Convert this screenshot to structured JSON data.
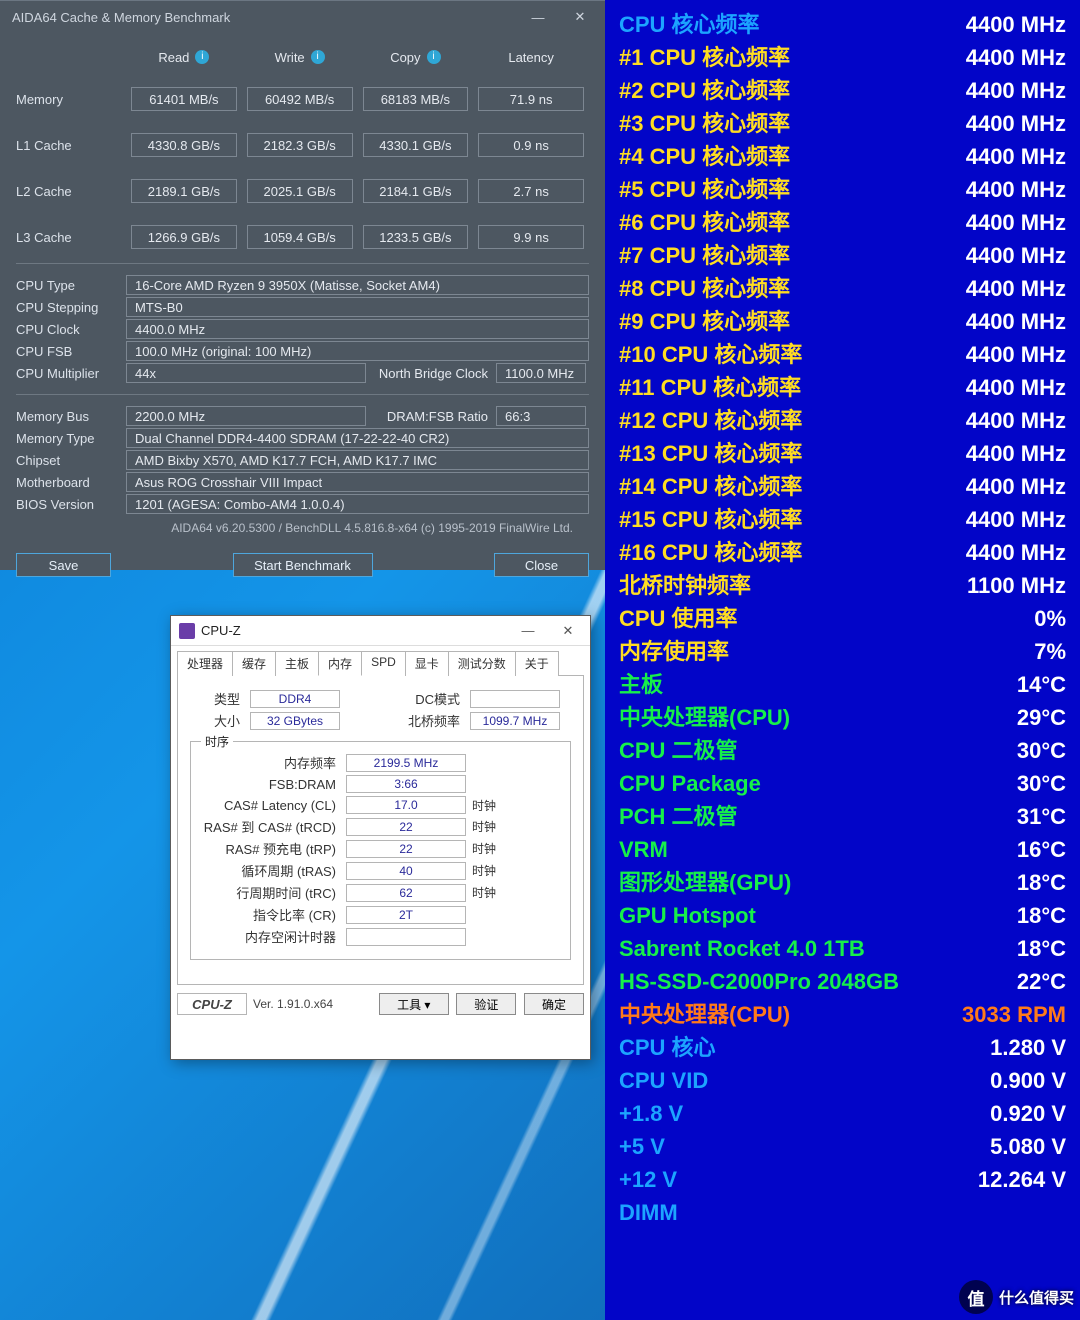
{
  "aida": {
    "title": "AIDA64 Cache & Memory Benchmark",
    "headers": {
      "read": "Read",
      "write": "Write",
      "copy": "Copy",
      "latency": "Latency"
    },
    "rows": [
      {
        "label": "Memory",
        "read": "61401 MB/s",
        "write": "60492 MB/s",
        "copy": "68183 MB/s",
        "latency": "71.9 ns"
      },
      {
        "label": "L1 Cache",
        "read": "4330.8 GB/s",
        "write": "2182.3 GB/s",
        "copy": "4330.1 GB/s",
        "latency": "0.9 ns"
      },
      {
        "label": "L2 Cache",
        "read": "2189.1 GB/s",
        "write": "2025.1 GB/s",
        "copy": "2184.1 GB/s",
        "latency": "2.7 ns"
      },
      {
        "label": "L3 Cache",
        "read": "1266.9 GB/s",
        "write": "1059.4 GB/s",
        "copy": "1233.5 GB/s",
        "latency": "9.9 ns"
      }
    ],
    "cpu": {
      "type_k": "CPU Type",
      "type_v": "16-Core AMD Ryzen 9 3950X  (Matisse, Socket AM4)",
      "step_k": "CPU Stepping",
      "step_v": "MTS-B0",
      "clock_k": "CPU Clock",
      "clock_v": "4400.0 MHz",
      "fsb_k": "CPU FSB",
      "fsb_v": "100.0 MHz   (original: 100 MHz)",
      "mult_k": "CPU Multiplier",
      "mult_v": "44x",
      "nb_k": "North Bridge Clock",
      "nb_v": "1100.0 MHz"
    },
    "mem": {
      "bus_k": "Memory Bus",
      "bus_v": "2200.0 MHz",
      "ratio_k": "DRAM:FSB Ratio",
      "ratio_v": "66:3",
      "type_k": "Memory Type",
      "type_v": "Dual Channel DDR4-4400 SDRAM   (17-22-22-40 CR2)",
      "chip_k": "Chipset",
      "chip_v": "AMD Bixby X570, AMD K17.7 FCH, AMD K17.7 IMC",
      "mb_k": "Motherboard",
      "mb_v": "Asus ROG Crosshair VIII Impact",
      "bios_k": "BIOS Version",
      "bios_v": "1201  (AGESA: Combo-AM4 1.0.0.4)"
    },
    "footer": "AIDA64 v6.20.5300 / BenchDLL 4.5.816.8-x64   (c) 1995-2019 FinalWire Ltd.",
    "buttons": {
      "save": "Save",
      "start": "Start Benchmark",
      "close": "Close"
    }
  },
  "cpuz": {
    "title": "CPU-Z",
    "tabs": [
      "处理器",
      "缓存",
      "主板",
      "内存",
      "SPD",
      "显卡",
      "测试分数",
      "关于"
    ],
    "active_tab": "内存",
    "type_k": "类型",
    "type_v": "DDR4",
    "size_k": "大小",
    "size_v": "32 GBytes",
    "dc_k": "DC模式",
    "nb_k": "北桥频率",
    "nb_v": "1099.7 MHz",
    "group": "时序",
    "timings": [
      {
        "k": "内存频率",
        "v": "2199.5 MHz",
        "u": ""
      },
      {
        "k": "FSB:DRAM",
        "v": "3:66",
        "u": ""
      },
      {
        "k": "CAS# Latency (CL)",
        "v": "17.0",
        "u": "时钟"
      },
      {
        "k": "RAS# 到 CAS# (tRCD)",
        "v": "22",
        "u": "时钟"
      },
      {
        "k": "RAS# 预充电 (tRP)",
        "v": "22",
        "u": "时钟"
      },
      {
        "k": "循环周期 (tRAS)",
        "v": "40",
        "u": "时钟"
      },
      {
        "k": "行周期时间 (tRC)",
        "v": "62",
        "u": "时钟"
      },
      {
        "k": "指令比率 (CR)",
        "v": "2T",
        "u": ""
      },
      {
        "k": "内存空闲计时器",
        "v": "",
        "u": "",
        "gray": true
      }
    ],
    "logo": "CPU-Z",
    "ver": "Ver. 1.91.0.x64",
    "btn_tool": "工具",
    "btn_verify": "验证",
    "btn_ok": "确定"
  },
  "mon": {
    "freq_rows": [
      {
        "cls": "blue",
        "k": "CPU 核心频率",
        "v": "4400 MHz"
      },
      {
        "cls": "yellow",
        "k": "#1 CPU 核心频率",
        "v": "4400 MHz"
      },
      {
        "cls": "yellow",
        "k": "#2 CPU 核心频率",
        "v": "4400 MHz"
      },
      {
        "cls": "yellow",
        "k": "#3 CPU 核心频率",
        "v": "4400 MHz"
      },
      {
        "cls": "yellow",
        "k": "#4 CPU 核心频率",
        "v": "4400 MHz"
      },
      {
        "cls": "yellow",
        "k": "#5 CPU 核心频率",
        "v": "4400 MHz"
      },
      {
        "cls": "yellow",
        "k": "#6 CPU 核心频率",
        "v": "4400 MHz"
      },
      {
        "cls": "yellow",
        "k": "#7 CPU 核心频率",
        "v": "4400 MHz"
      },
      {
        "cls": "yellow",
        "k": "#8 CPU 核心频率",
        "v": "4400 MHz"
      },
      {
        "cls": "yellow",
        "k": "#9 CPU 核心频率",
        "v": "4400 MHz"
      },
      {
        "cls": "yellow",
        "k": "#10 CPU 核心频率",
        "v": "4400 MHz"
      },
      {
        "cls": "yellow",
        "k": "#11 CPU 核心频率",
        "v": "4400 MHz"
      },
      {
        "cls": "yellow",
        "k": "#12 CPU 核心频率",
        "v": "4400 MHz"
      },
      {
        "cls": "yellow",
        "k": "#13 CPU 核心频率",
        "v": "4400 MHz"
      },
      {
        "cls": "yellow",
        "k": "#14 CPU 核心频率",
        "v": "4400 MHz"
      },
      {
        "cls": "yellow",
        "k": "#15 CPU 核心频率",
        "v": "4400 MHz"
      },
      {
        "cls": "yellow",
        "k": "#16 CPU 核心频率",
        "v": "4400 MHz"
      },
      {
        "cls": "yellow",
        "k": "北桥时钟频率",
        "v": "1100 MHz"
      },
      {
        "cls": "yellow",
        "k": "CPU 使用率",
        "v": "0%"
      },
      {
        "cls": "yellow",
        "k": "内存使用率",
        "v": "7%"
      },
      {
        "cls": "green",
        "k": "主板",
        "v": "14°C"
      },
      {
        "cls": "green",
        "k": "中央处理器(CPU)",
        "v": "29°C"
      },
      {
        "cls": "green",
        "k": "CPU 二极管",
        "v": "30°C"
      },
      {
        "cls": "green",
        "k": "CPU Package",
        "v": "30°C"
      },
      {
        "cls": "green",
        "k": "PCH 二极管",
        "v": "31°C"
      },
      {
        "cls": "green",
        "k": "VRM",
        "v": "16°C"
      },
      {
        "cls": "green",
        "k": "图形处理器(GPU)",
        "v": "18°C"
      },
      {
        "cls": "green",
        "k": "GPU Hotspot",
        "v": "18°C"
      },
      {
        "cls": "green",
        "k": "Sabrent Rocket 4.0 1TB",
        "v": "18°C"
      },
      {
        "cls": "green",
        "k": "HS-SSD-C2000Pro 2048GB",
        "v": "22°C"
      },
      {
        "cls": "orange",
        "k": "中央处理器(CPU)",
        "v": "3033 RPM",
        "vcls": "orange"
      },
      {
        "cls": "blue",
        "k": "CPU 核心",
        "v": "1.280 V"
      },
      {
        "cls": "blue",
        "k": "CPU VID",
        "v": "0.900 V"
      },
      {
        "cls": "blue",
        "k": "+1.8 V",
        "v": "0.920 V"
      },
      {
        "cls": "blue",
        "k": "+5 V",
        "v": "5.080 V"
      },
      {
        "cls": "blue",
        "k": "+12 V",
        "v": "12.264 V"
      },
      {
        "cls": "blue",
        "k": "DIMM",
        "v": ""
      }
    ]
  },
  "badge": {
    "glyph": "值",
    "text": "什么值得买"
  }
}
